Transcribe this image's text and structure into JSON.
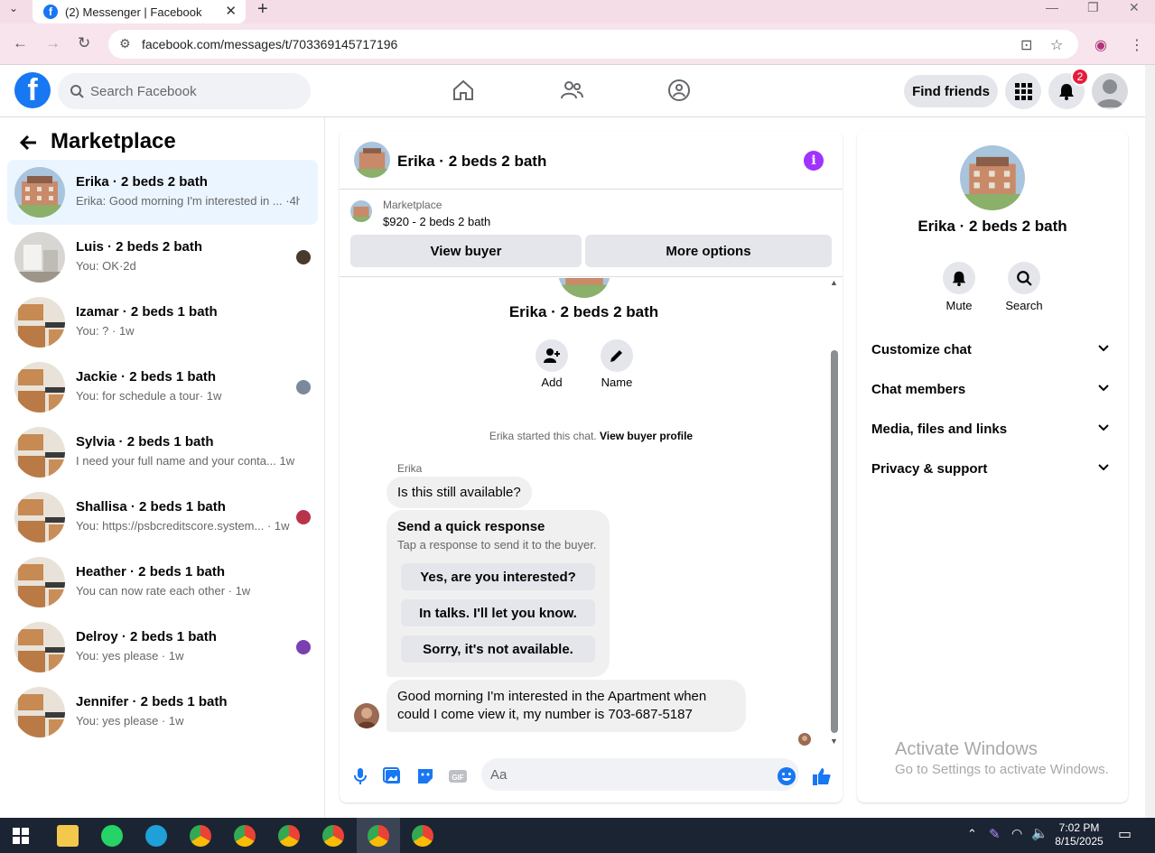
{
  "browser": {
    "tab_title": "(2) Messenger | Facebook",
    "url": "facebook.com/messages/t/703369145717196"
  },
  "header": {
    "search_placeholder": "Search Facebook",
    "find_friends": "Find friends",
    "notification_count": "2"
  },
  "sidebar": {
    "title": "Marketplace",
    "conversations": [
      {
        "name": "Erika · 2 beds 2 bath",
        "preview": "Erika: Good morning I'm interested in ... ·4h",
        "active": true
      },
      {
        "name": "Luis · 2 beds 2 bath",
        "preview": "You: OK·2d"
      },
      {
        "name": "Izamar · 2 beds 1 bath",
        "preview": "You: ? · 1w"
      },
      {
        "name": "Jackie · 2 beds 1 bath",
        "preview": "You: for schedule a tour· 1w"
      },
      {
        "name": "Sylvia · 2 beds 1 bath",
        "preview": "I need your full name and your conta...  1w"
      },
      {
        "name": "Shallisa · 2 beds 1 bath",
        "preview": "You: https://psbcreditscore.system... · 1w"
      },
      {
        "name": "Heather · 2 beds 1 bath",
        "preview": "You can now rate each other · 1w"
      },
      {
        "name": "Delroy · 2 beds 1 bath",
        "preview": "You: yes please · 1w"
      },
      {
        "name": "Jennifer · 2 beds 1 bath",
        "preview": "You: yes please · 1w"
      }
    ]
  },
  "chat": {
    "title": "Erika · 2 beds 2 bath",
    "marketplace_label": "Marketplace",
    "listing": "$920 - 2 beds 2 bath",
    "view_buyer": "View buyer",
    "more_options": "More options",
    "center_name": "Erika · 2 beds 2 bath",
    "add_label": "Add",
    "name_label": "Name",
    "system_prefix": "Erika started this chat.",
    "system_link": "View buyer profile",
    "sender": "Erika",
    "messages": [
      "Is this still available?",
      "Good morning I'm interested in the Apartment when could I come view it, my number is 703-687-5187"
    ],
    "quick_title": "Send a quick response",
    "quick_subtitle": "Tap a response to send it to the buyer.",
    "quick_responses": [
      "Yes, are you interested?",
      "In talks. I'll let you know.",
      "Sorry, it's not available."
    ],
    "composer_placeholder": "Aa"
  },
  "right_panel": {
    "title": "Erika · 2 beds 2 bath",
    "mute": "Mute",
    "search": "Search",
    "sections": [
      "Customize chat",
      "Chat members",
      "Media, files and links",
      "Privacy & support"
    ]
  },
  "watermark": {
    "line1": "Activate Windows",
    "line2": "Go to Settings to activate Windows."
  },
  "taskbar": {
    "time": "7:02 PM",
    "date": "8/15/2025"
  },
  "colors": {
    "facebook_blue": "#1877f2",
    "messenger_purple": "#a033ff",
    "notification_red": "#e41e3f"
  }
}
